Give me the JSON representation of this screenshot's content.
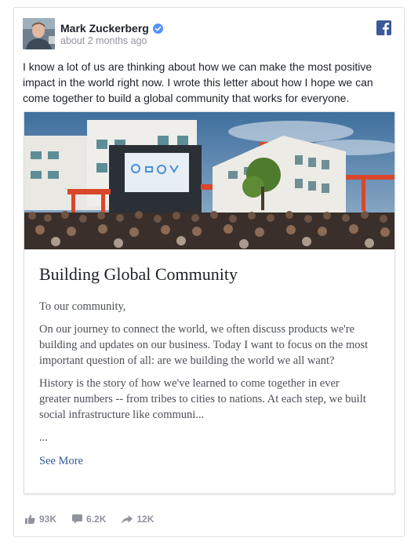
{
  "post": {
    "author": "Mark Zuckerberg",
    "timestamp": "about 2 months ago",
    "text": "I know a lot of us are thinking about how we can make the most positive impact in the world right now. I wrote this letter about how I hope we can come together to build a global community that works for everyone."
  },
  "card": {
    "title": "Building Global Community",
    "greeting": "To our community,",
    "paragraph1": "On our journey to connect the world, we often discuss products we're building and updates on our business. Today I want to focus on the most important question of all: are we building the world we all want?",
    "paragraph2": "History is the story of how we've learned to come together in ever greater numbers -- from tribes to cities to nations. At each step, we built social infrastructure like communi...",
    "ellipsis": "...",
    "see_more": "See More"
  },
  "stats": {
    "likes": "93K",
    "comments": "6.2K",
    "shares": "12K"
  },
  "colors": {
    "link": "#365899",
    "facebook_blue": "#3b5998",
    "muted": "#90949c",
    "verified": "#5890ff"
  },
  "icons": [
    "facebook-logo-icon",
    "verified-badge-icon",
    "like-icon",
    "comment-icon",
    "share-icon"
  ]
}
